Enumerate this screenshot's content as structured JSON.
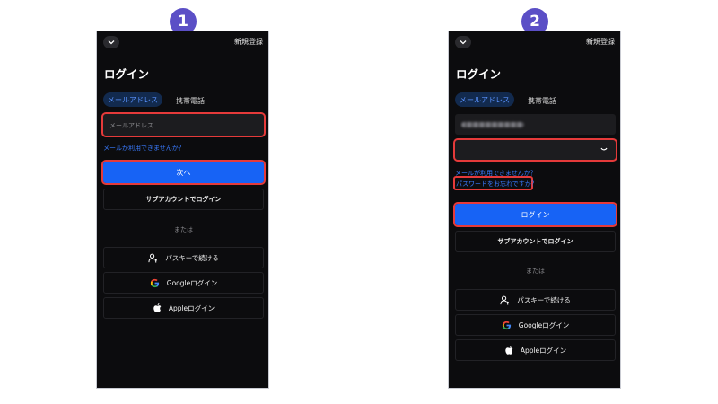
{
  "steps": [
    "1",
    "2"
  ],
  "screen1": {
    "signup": "新規登録",
    "title": "ログイン",
    "tab_email": "メールアドレス",
    "tab_phone": "携帯電話",
    "email_placeholder": "メールアドレス",
    "email_unavailable_link": "メールが利用できませんか？",
    "next_button": "次へ",
    "subaccount_button": "サブアカウントでログイン",
    "or_text": "または",
    "passkey_button": "パスキーで続ける",
    "google_button": "Googleログイン",
    "apple_button": "Appleログイン"
  },
  "screen2": {
    "signup": "新規登録",
    "title": "ログイン",
    "tab_email": "メールアドレス",
    "tab_phone": "携帯電話",
    "email_unavailable_link": "メールが利用できませんか？",
    "forgot_password_link": "パスワードをお忘れですか？",
    "login_button": "ログイン",
    "subaccount_button": "サブアカウントでログイン",
    "or_text": "または",
    "passkey_button": "パスキーで続ける",
    "google_button": "Googleログイン",
    "apple_button": "Appleログイン"
  },
  "colors": {
    "step_badge": "#5b4fc6",
    "highlight": "#e53a3a",
    "primary": "#1763f5",
    "link": "#3a7bff",
    "background": "#0c0c0e"
  },
  "icons": [
    "chevron-down-icon",
    "passkey-icon",
    "google-icon",
    "apple-icon",
    "eye-closed-icon"
  ]
}
